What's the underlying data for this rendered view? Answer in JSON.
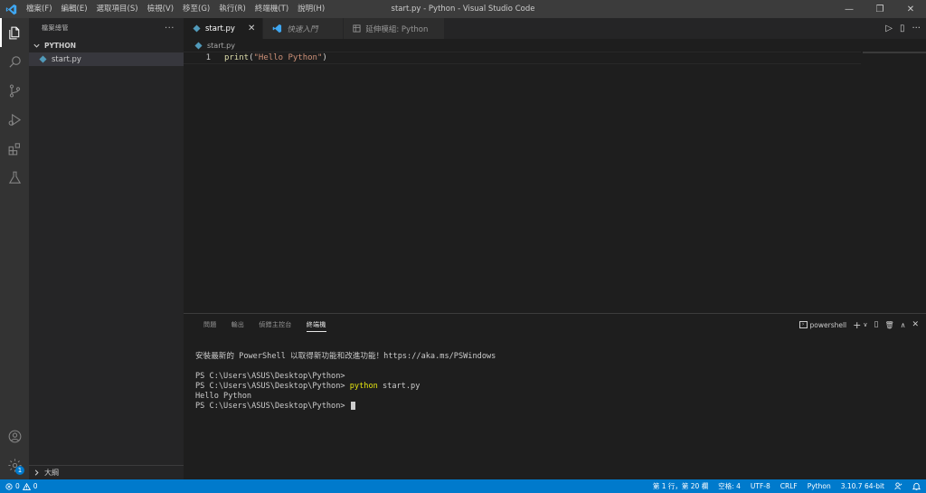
{
  "window": {
    "title": "start.py - Python - Visual Studio Code",
    "menu": [
      "檔案(F)",
      "編輯(E)",
      "選取項目(S)",
      "檢視(V)",
      "移至(G)",
      "執行(R)",
      "終端機(T)",
      "說明(H)"
    ],
    "controls": {
      "minimize": "—",
      "restore": "❐",
      "close": "✕"
    }
  },
  "activity_bar": {
    "icons": [
      "explorer-icon",
      "search-icon",
      "source-control-icon",
      "run-debug-icon",
      "extensions-icon",
      "testing-icon"
    ],
    "bottom_icons": [
      "accounts-icon",
      "manage-icon"
    ],
    "manage_badge": "1"
  },
  "sidebar": {
    "header": "檔案總管",
    "more": "···",
    "folder_name": "PYTHON",
    "files": [
      {
        "name": "start.py",
        "selected": true
      }
    ],
    "outline_label": "大綱"
  },
  "editor": {
    "tabs": [
      {
        "label": "start.py",
        "active": true,
        "close": "✕"
      },
      {
        "label": "快速入門",
        "active": false,
        "italic": true
      },
      {
        "label": "延伸模組: Python",
        "active": false
      }
    ],
    "breadcrumb": "start.py",
    "lines": [
      {
        "number": "1",
        "fn": "print",
        "open": "(",
        "string": "\"Hello Python\"",
        "close": ")"
      }
    ],
    "actions": {
      "run": "▷",
      "split": "▯",
      "more": "···"
    }
  },
  "panel": {
    "tabs": [
      "問題",
      "輸出",
      "偵錯主控台",
      "終端機"
    ],
    "active_tab": "終端機",
    "terminal_name": "powershell",
    "actions": {
      "add": "+",
      "dropdown": "∨",
      "split": "▯",
      "trash": "🗑",
      "maximize": "∧",
      "close": "✕"
    },
    "terminal_lines": {
      "l1": "安裝最新的 PowerShell 以取得新功能和改進功能！https://aka.ms/PSWindows",
      "l2": "",
      "l3": "PS C:\\Users\\ASUS\\Desktop\\Python>",
      "l4_prompt": "PS C:\\Users\\ASUS\\Desktop\\Python> ",
      "l4_cmd": "python",
      "l4_args": " start.py",
      "l5": "Hello Python",
      "l6": "PS C:\\Users\\ASUS\\Desktop\\Python> "
    }
  },
  "status_bar": {
    "errors": "0",
    "warnings": "0",
    "position": "第 1 行，第 20 欄",
    "spaces": "空格: 4",
    "encoding": "UTF-8",
    "eol": "CRLF",
    "language": "Python",
    "interpreter": "3.10.7 64-bit"
  },
  "colors": {
    "accent": "#007acc",
    "titlebar": "#3c3c3c",
    "sidebar": "#252526",
    "editor": "#1e1e1e"
  }
}
